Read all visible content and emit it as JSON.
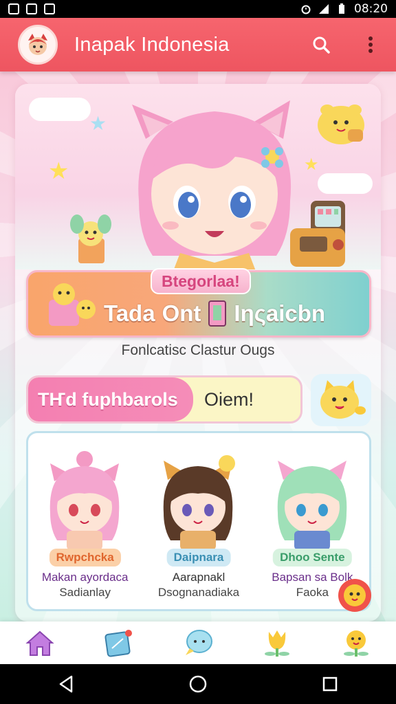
{
  "status_bar": {
    "time": "08:20",
    "icons": [
      "image-icon",
      "message-icon",
      "photo-icon",
      "alarm-icon",
      "signal-icon",
      "battery-icon"
    ]
  },
  "app_bar": {
    "title": "Inapak Indonesia",
    "avatar_icon": "mascot-avatar-icon",
    "actions": [
      "search-icon",
      "more-vert-icon"
    ]
  },
  "banner": {
    "badge": "Btegorlaa!",
    "title_part1": "Tada",
    "title_part2": "Ont",
    "title_part3": "Iηςaicbn",
    "subtitle": "Fonlcatisc Clastur Ougs"
  },
  "pill": {
    "left_label": "TҤd fuphbarols",
    "right_label": "Oiem!"
  },
  "characters": [
    {
      "badge": "Rwpchcka",
      "name_line1": "Makan ayordaca",
      "name_line2": "Sadianlay",
      "badge_bg": "#fbd0a8",
      "badge_color": "#e0662e"
    },
    {
      "badge": "Daipnara",
      "name_line1": "Aarapnakl",
      "name_line2": "Dsognanadiaka",
      "badge_bg": "#cfe9f4",
      "badge_color": "#3a8fb3"
    },
    {
      "badge": "Dhoo Sente",
      "name_line1": "Bapsan sa Bolk",
      "name_line2": "Faoka",
      "badge_bg": "#d7f2df",
      "badge_color": "#3a9d6a"
    }
  ],
  "bottom_nav": [
    "home-icon",
    "sticker-icon",
    "chat-icon",
    "tulip-icon",
    "flower-icon"
  ],
  "system_nav": [
    "back-icon",
    "home-circle-icon",
    "recents-icon"
  ],
  "colors": {
    "app_bar": "#f25f69",
    "accent_pink": "#f47fb1",
    "nav_purple": "#b06ad6"
  }
}
